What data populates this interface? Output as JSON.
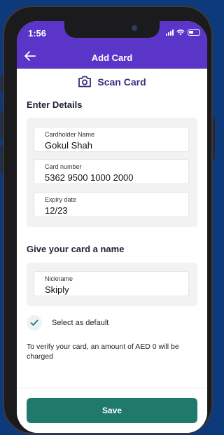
{
  "status_bar": {
    "time": "1:56"
  },
  "header": {
    "back_icon": "arrow-left-icon",
    "title": "Add Card"
  },
  "scan": {
    "icon": "camera-icon",
    "label": "Scan Card"
  },
  "details": {
    "title": "Enter Details",
    "fields": [
      {
        "label": "Cardholder Name",
        "value": "Gokul Shah"
      },
      {
        "label": "Card number",
        "value": "5362 9500 1000 2000"
      },
      {
        "label": "Expiry date",
        "value": "12/23"
      }
    ]
  },
  "name_section": {
    "title": "Give your card a name",
    "field": {
      "label": "Nickname",
      "value": "Skiply"
    }
  },
  "default_option": {
    "label": "Select as default",
    "checked": true
  },
  "note": "To verify your card, an amount of AED 0 will be charged",
  "footer": {
    "save_label": "Save"
  },
  "colors": {
    "header": "#5b34c8",
    "accent_text": "#3a2b82",
    "save_button": "#1f7a6c",
    "background": "#0d3a7a"
  }
}
